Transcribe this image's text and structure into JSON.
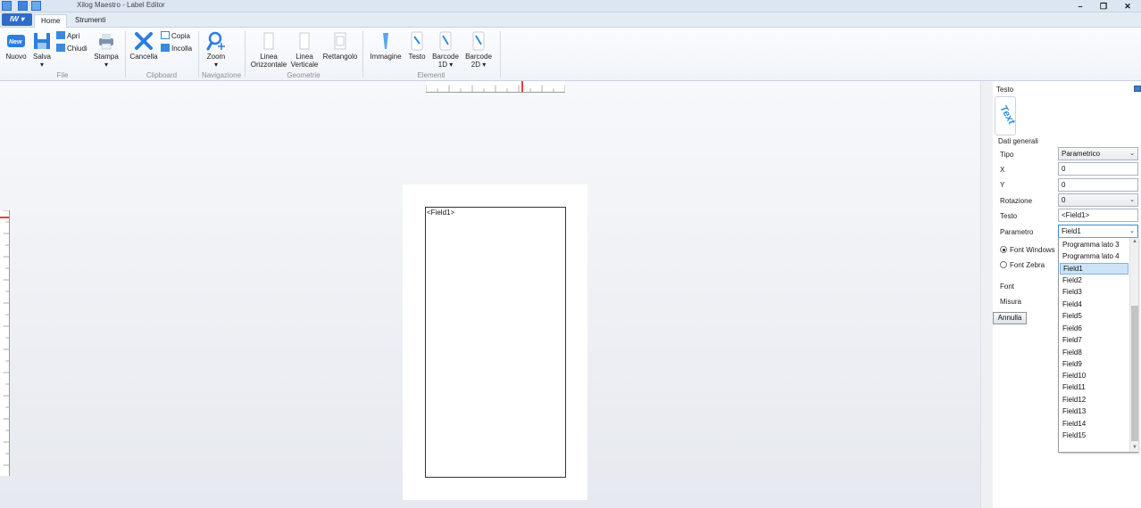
{
  "window": {
    "title": "Xilog Maestro - Label Editor",
    "minimize": "–",
    "restore": "❐",
    "close": "✕"
  },
  "app_menu": {
    "label": "IW ▾"
  },
  "tabs": [
    {
      "label": "Home",
      "active": true
    },
    {
      "label": "Strumenti",
      "active": false
    }
  ],
  "ribbon": {
    "file": {
      "group_label": "File",
      "nuovo": "Nuovo",
      "salva": "Salva",
      "apri": "Apri",
      "chiudi": "Chiudi",
      "stampa": "Stampa"
    },
    "clipboard": {
      "group_label": "Clipboard",
      "cancella": "Cancella",
      "copia": "Copia",
      "incolla": "Incolla"
    },
    "navigazione": {
      "group_label": "Navigazione",
      "zoom": "Zoom"
    },
    "geometrie": {
      "group_label": "Geometrie",
      "linea_orizzontale_1": "Linea",
      "linea_orizzontale_2": "Orizzontale",
      "linea_verticale_1": "Linea",
      "linea_verticale_2": "Verticale",
      "rettangolo": "Rettangolo"
    },
    "elementi": {
      "group_label": "Elementi",
      "immagine": "Immagine",
      "testo": "Testo",
      "barcode1d_1": "Barcode",
      "barcode1d_2": "1D ▾",
      "barcode2d_1": "Barcode",
      "barcode2d_2": "2D ▾"
    }
  },
  "canvas": {
    "field_text": "<Field1>"
  },
  "properties": {
    "panel_title": "Testo",
    "tile_text": "Text",
    "section": "Dati generali",
    "rows": {
      "tipo_label": "Tipo",
      "tipo_value": "Parametrico",
      "x_label": "X",
      "x_value": "0",
      "y_label": "Y",
      "y_value": "0",
      "rotazione_label": "Rotazione",
      "rotazione_value": "0",
      "testo_label": "Testo",
      "testo_value": "<Field1>",
      "parametro_label": "Parametro",
      "parametro_value": "Field1",
      "font_windows": "Font Windows",
      "font_zebra": "Font Zebra",
      "font_label": "Font",
      "misura_label": "Misura"
    },
    "annulla": "Annulla"
  },
  "dropdown": {
    "items": [
      "Programma lato 3",
      "Programma lato 4",
      "Field1",
      "Field2",
      "Field3",
      "Field4",
      "Field5",
      "Field6",
      "Field7",
      "Field8",
      "Field9",
      "Field10",
      "Field11",
      "Field12",
      "Field13",
      "Field14",
      "Field15"
    ],
    "selected": "Field1"
  },
  "colors": {
    "accent": "#2f6cc6",
    "selection": "#cde4f7"
  }
}
